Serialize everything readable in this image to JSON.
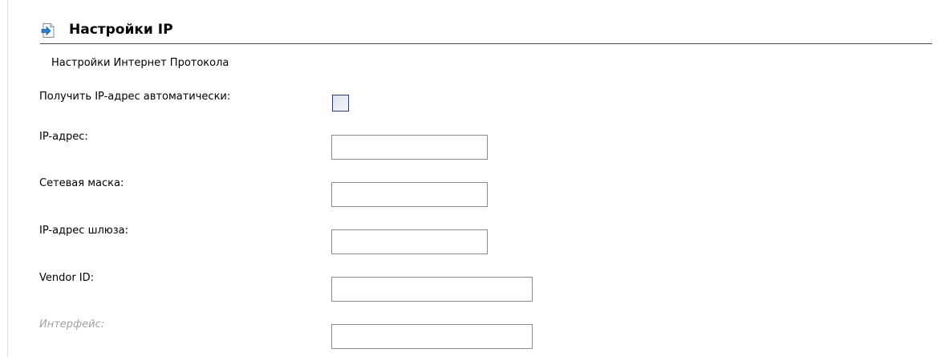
{
  "section": {
    "title": "Настройки IP",
    "icon": "arrow-document-icon"
  },
  "subsection": {
    "title": "Настройки Интернет Протокола"
  },
  "form": {
    "auto_ip": {
      "label": "Получить IP-адрес автоматически:",
      "checked": false
    },
    "ip_address": {
      "label": "IP-адрес:",
      "value": ""
    },
    "netmask": {
      "label": "Сетевая маска:",
      "value": ""
    },
    "gateway": {
      "label": "IP-адрес шлюза:",
      "value": ""
    },
    "vendor_id": {
      "label": "Vendor ID:",
      "value": ""
    },
    "interface": {
      "label": "Интерфейс:",
      "value": "",
      "disabled": true
    }
  },
  "colors": {
    "header_rule": "#4a4a4a",
    "checkbox_border": "#2e3e6a",
    "input_border": "#8c8c8c",
    "disabled_text": "#a0a0a0",
    "icon_accent": "#2a7fd4"
  }
}
